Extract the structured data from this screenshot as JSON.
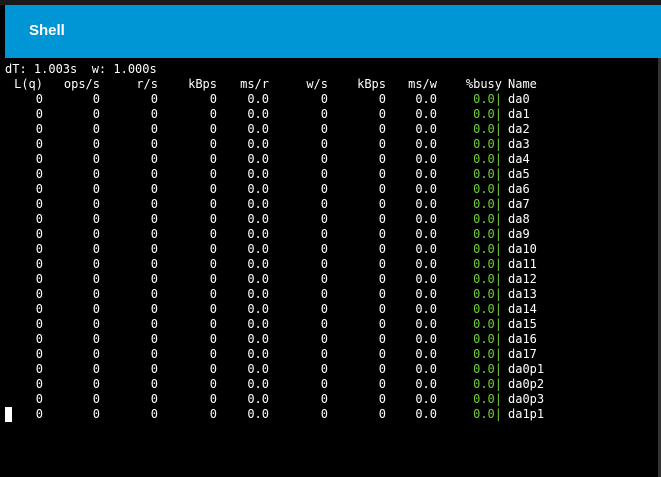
{
  "window": {
    "title": "Shell"
  },
  "terminal": {
    "status_line": "dT: 1.003s  w: 1.000s",
    "headers": [
      "L(q)",
      "ops/s",
      "r/s",
      "kBps",
      "ms/r",
      "w/s",
      "kBps",
      "ms/w",
      "%busy",
      "Name"
    ],
    "rows": [
      [
        "0",
        "0",
        "0",
        "0",
        "0.0",
        "0",
        "0",
        "0.0",
        "0.0|",
        "da0"
      ],
      [
        "0",
        "0",
        "0",
        "0",
        "0.0",
        "0",
        "0",
        "0.0",
        "0.0|",
        "da1"
      ],
      [
        "0",
        "0",
        "0",
        "0",
        "0.0",
        "0",
        "0",
        "0.0",
        "0.0|",
        "da2"
      ],
      [
        "0",
        "0",
        "0",
        "0",
        "0.0",
        "0",
        "0",
        "0.0",
        "0.0|",
        "da3"
      ],
      [
        "0",
        "0",
        "0",
        "0",
        "0.0",
        "0",
        "0",
        "0.0",
        "0.0|",
        "da4"
      ],
      [
        "0",
        "0",
        "0",
        "0",
        "0.0",
        "0",
        "0",
        "0.0",
        "0.0|",
        "da5"
      ],
      [
        "0",
        "0",
        "0",
        "0",
        "0.0",
        "0",
        "0",
        "0.0",
        "0.0|",
        "da6"
      ],
      [
        "0",
        "0",
        "0",
        "0",
        "0.0",
        "0",
        "0",
        "0.0",
        "0.0|",
        "da7"
      ],
      [
        "0",
        "0",
        "0",
        "0",
        "0.0",
        "0",
        "0",
        "0.0",
        "0.0|",
        "da8"
      ],
      [
        "0",
        "0",
        "0",
        "0",
        "0.0",
        "0",
        "0",
        "0.0",
        "0.0|",
        "da9"
      ],
      [
        "0",
        "0",
        "0",
        "0",
        "0.0",
        "0",
        "0",
        "0.0",
        "0.0|",
        "da10"
      ],
      [
        "0",
        "0",
        "0",
        "0",
        "0.0",
        "0",
        "0",
        "0.0",
        "0.0|",
        "da11"
      ],
      [
        "0",
        "0",
        "0",
        "0",
        "0.0",
        "0",
        "0",
        "0.0",
        "0.0|",
        "da12"
      ],
      [
        "0",
        "0",
        "0",
        "0",
        "0.0",
        "0",
        "0",
        "0.0",
        "0.0|",
        "da13"
      ],
      [
        "0",
        "0",
        "0",
        "0",
        "0.0",
        "0",
        "0",
        "0.0",
        "0.0|",
        "da14"
      ],
      [
        "0",
        "0",
        "0",
        "0",
        "0.0",
        "0",
        "0",
        "0.0",
        "0.0|",
        "da15"
      ],
      [
        "0",
        "0",
        "0",
        "0",
        "0.0",
        "0",
        "0",
        "0.0",
        "0.0|",
        "da16"
      ],
      [
        "0",
        "0",
        "0",
        "0",
        "0.0",
        "0",
        "0",
        "0.0",
        "0.0|",
        "da17"
      ],
      [
        "0",
        "0",
        "0",
        "0",
        "0.0",
        "0",
        "0",
        "0.0",
        "0.0|",
        "da0p1"
      ],
      [
        "0",
        "0",
        "0",
        "0",
        "0.0",
        "0",
        "0",
        "0.0",
        "0.0|",
        "da0p2"
      ],
      [
        "0",
        "0",
        "0",
        "0",
        "0.0",
        "0",
        "0",
        "0.0",
        "0.0|",
        "da0p3"
      ],
      [
        "0",
        "0",
        "0",
        "0",
        "0.0",
        "0",
        "0",
        "0.0",
        "0.0|",
        "da1p1"
      ]
    ]
  },
  "colors": {
    "titlebar": "#0095D5",
    "background": "#000000",
    "text": "#FFFFFF",
    "busy": "#6ECF3C"
  }
}
